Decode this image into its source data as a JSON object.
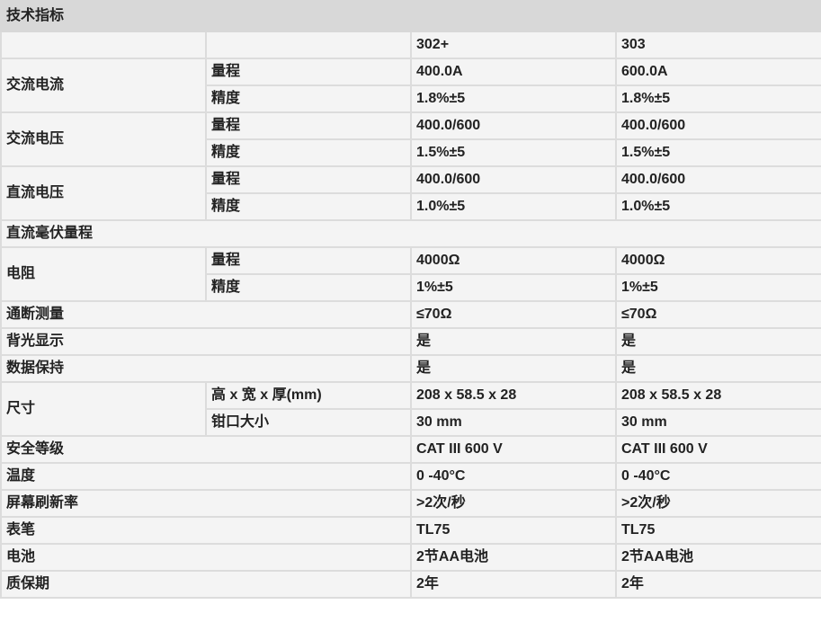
{
  "title": "技术指标",
  "models": [
    "302+",
    "303"
  ],
  "ac_current": {
    "label": "交流电流",
    "range_label": "量程",
    "range": [
      "400.0A",
      "600.0A"
    ],
    "accuracy_label": "精度",
    "accuracy": [
      "1.8%±5",
      "1.8%±5"
    ]
  },
  "ac_voltage": {
    "label": "交流电压",
    "range_label": "量程",
    "range": [
      "400.0/600",
      "400.0/600"
    ],
    "accuracy_label": "精度",
    "accuracy": [
      "1.5%±5",
      "1.5%±5"
    ]
  },
  "dc_voltage": {
    "label": "直流电压",
    "range_label": "量程",
    "range": [
      "400.0/600",
      "400.0/600"
    ],
    "accuracy_label": "精度",
    "accuracy": [
      "1.0%±5",
      "1.0%±5"
    ]
  },
  "dc_mv_range": {
    "label": "直流毫伏量程"
  },
  "resistance": {
    "label": "电阻",
    "range_label": "量程",
    "range": [
      "4000Ω",
      "4000Ω"
    ],
    "accuracy_label": "精度",
    "accuracy": [
      "1%±5",
      "1%±5"
    ]
  },
  "continuity": {
    "label": "通断测量",
    "values": [
      "≤70Ω",
      "≤70Ω"
    ]
  },
  "backlight": {
    "label": "背光显示",
    "values": [
      "是",
      "是"
    ]
  },
  "data_hold": {
    "label": "数据保持",
    "values": [
      "是",
      "是"
    ]
  },
  "size": {
    "label": "尺寸",
    "dims_label": "高 x 宽 x 厚(mm)",
    "dims": [
      "208 x 58.5 x 28",
      "208 x 58.5 x 28"
    ],
    "jaw_label": "钳口大小",
    "jaw": [
      "30 mm",
      "30 mm"
    ]
  },
  "safety": {
    "label": "安全等级",
    "values": [
      "CAT III 600 V",
      "CAT III 600 V"
    ]
  },
  "temperature": {
    "label": "温度",
    "values": [
      "0 -40°C",
      "0 -40°C"
    ]
  },
  "refresh": {
    "label": "屏幕刷新率",
    "values": [
      ">2次/秒",
      ">2次/秒"
    ]
  },
  "test_leads": {
    "label": "表笔",
    "values": [
      "TL75",
      "TL75"
    ]
  },
  "battery": {
    "label": "电池",
    "values": [
      "2节AA电池",
      "2节AA电池"
    ]
  },
  "warranty": {
    "label": "质保期",
    "values": [
      "2年",
      "2年"
    ]
  }
}
